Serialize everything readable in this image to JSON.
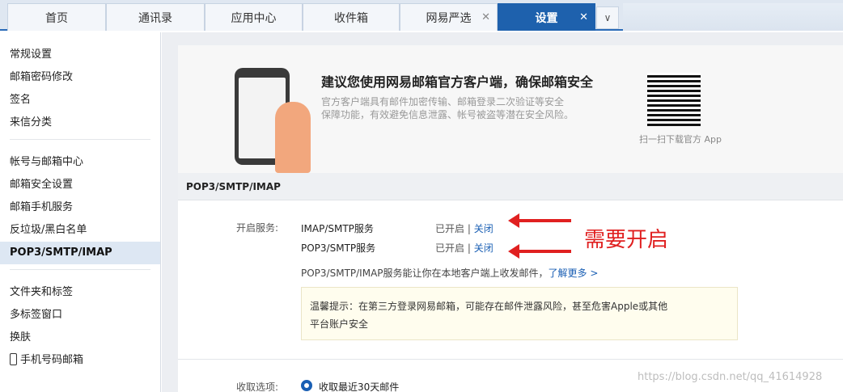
{
  "tabs": [
    {
      "label": "首页",
      "closable": false
    },
    {
      "label": "通讯录",
      "closable": false
    },
    {
      "label": "应用中心",
      "closable": false
    },
    {
      "label": "收件箱",
      "closable": false
    },
    {
      "label": "网易严选",
      "closable": true
    },
    {
      "label": "设置",
      "closable": true,
      "active": true
    }
  ],
  "tab_more_icon": "chevron-down",
  "sidebar": {
    "group1": [
      "常规设置",
      "邮箱密码修改",
      "签名",
      "来信分类"
    ],
    "group2": [
      "帐号与邮箱中心",
      "邮箱安全设置",
      "邮箱手机服务",
      "反垃圾/黑白名单",
      "POP3/SMTP/IMAP"
    ],
    "group3": [
      "文件夹和标签",
      "多标签窗口",
      "换肤",
      "手机号码邮箱"
    ],
    "active": "POP3/SMTP/IMAP"
  },
  "banner": {
    "title": "建议您使用网易邮箱官方客户端，确保邮箱安全",
    "desc_line1": "官方客户端具有邮件加密传输、邮箱登录二次验证等安全",
    "desc_line2": "保障功能，有效避免信息泄露、帐号被盗等潜在安全风险。",
    "qr_caption": "扫一扫下载官方 App"
  },
  "panel": {
    "title": "POP3/SMTP/IMAP",
    "enable_label": "开启服务:",
    "services": [
      {
        "name": "IMAP/SMTP服务",
        "status": "已开启",
        "sep": " | ",
        "action": "关闭"
      },
      {
        "name": "POP3/SMTP服务",
        "status": "已开启",
        "sep": " | ",
        "action": "关闭"
      }
    ],
    "info_text": "POP3/SMTP/IMAP服务能让你在本地客户端上收发邮件，",
    "info_link": "了解更多 >",
    "notice_line1": "温馨提示：在第三方登录网易邮箱，可能存在邮件泄露风险，甚至危害Apple或其他",
    "notice_line2": "平台账户安全",
    "receive_label": "收取选项:",
    "receive_option": "收取最近30天邮件"
  },
  "annotation": "需要开启",
  "watermark": "https://blog.csdn.net/qq_41614928",
  "colors": {
    "accent": "#1e61ad",
    "annotation": "#e02020",
    "link": "#1a5fb4"
  }
}
